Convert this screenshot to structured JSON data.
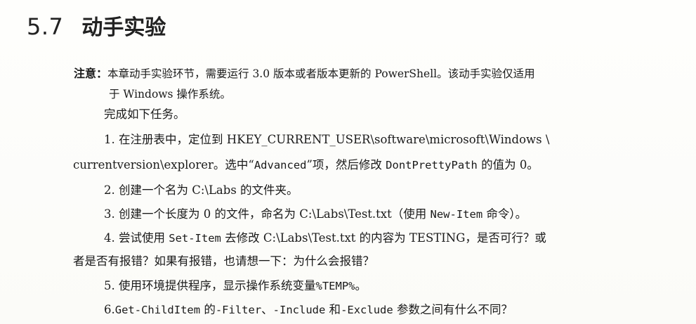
{
  "heading": {
    "number": "5.7",
    "title": "动手实验"
  },
  "note": {
    "label": "注意：",
    "line1": "本章动手实验环节，需要运行 3.0 版本或者版本更新的 PowerShell。该动手实验仅适用",
    "line2": "于 Windows 操作系统。"
  },
  "intro": "完成如下任务。",
  "task1": {
    "line1": "1. 在注册表中，定位到 HKEY_CURRENT_USER\\software\\microsoft\\Windows \\",
    "line2_a": "currentversion\\explorer。选中“",
    "line2_code1": "Advanced",
    "line2_b": "”项，然后修改 ",
    "line2_code2": "DontPrettyPath",
    "line2_c": " 的值为 0。"
  },
  "task2": "2. 创建一个名为 C:\\Labs 的文件夹。",
  "task3": {
    "a": "3. 创建一个长度为 0 的文件，命名为 C:\\Labs\\Test.txt（使用 ",
    "code": "New-Item",
    "b": " 命令）。"
  },
  "task4": {
    "a": "4. 尝试使用 ",
    "code": "Set-Item",
    "b": " 去修改 C:\\Labs\\Test.txt 的内容为 TESTING，是否可行？或",
    "line2": "者是否有报错？如果有报错，也请想一下：为什么会报错？"
  },
  "task5": {
    "a": "5. 使用环境提供程序，显示操作系统变量",
    "code": "%TEMP%",
    "b": "。"
  },
  "task6": {
    "a": "6.",
    "code1": "Get-ChildItem",
    "b": " 的",
    "code2": "-Filter",
    "c": "、",
    "code3": "-Include",
    "d": " 和",
    "code4": "-Exclude",
    "e": " 参数之间有什么不同？"
  }
}
